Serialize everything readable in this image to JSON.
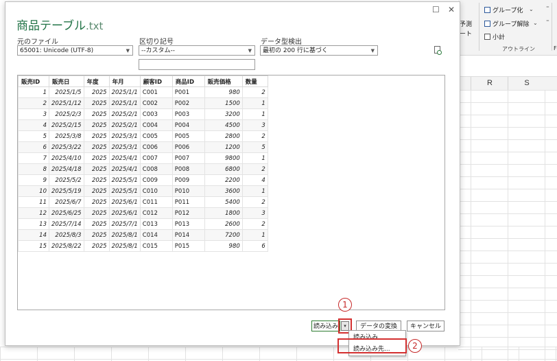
{
  "ribbon": {
    "items": [
      {
        "label": "グループ化",
        "icon": "group-icon"
      },
      {
        "label": "グループ解除",
        "icon": "ungroup-icon"
      },
      {
        "label": "小計",
        "icon": "subtotal-icon"
      }
    ],
    "group_label": "アウトライン",
    "partial_left_1": "予測",
    "partial_left_2": "ート",
    "partial_right": "F"
  },
  "spreadsheet": {
    "columns": [
      "R",
      "S"
    ]
  },
  "dialog": {
    "title": "商品テーブル",
    "title_ext": ".txt",
    "file_origin": {
      "label": "元のファイル",
      "value": "65001: Unicode (UTF-8)"
    },
    "delimiter": {
      "label": "区切り記号",
      "value": "--カスタム--",
      "custom_value": ""
    },
    "datatype": {
      "label": "データ型検出",
      "value": "最初の 200 行に基づく"
    },
    "table": {
      "headers": [
        "販売ID",
        "販売日",
        "年度",
        "年月",
        "顧客ID",
        "商品ID",
        "販売価格",
        "数量"
      ],
      "rows": [
        [
          "1",
          "2025/1/5",
          "2025",
          "2025/1/1",
          "C001",
          "P001",
          "980",
          "2"
        ],
        [
          "2",
          "2025/1/12",
          "2025",
          "2025/1/1",
          "C002",
          "P002",
          "1500",
          "1"
        ],
        [
          "3",
          "2025/2/3",
          "2025",
          "2025/2/1",
          "C003",
          "P003",
          "3200",
          "1"
        ],
        [
          "4",
          "2025/2/15",
          "2025",
          "2025/2/1",
          "C004",
          "P004",
          "4500",
          "3"
        ],
        [
          "5",
          "2025/3/8",
          "2025",
          "2025/3/1",
          "C005",
          "P005",
          "2800",
          "2"
        ],
        [
          "6",
          "2025/3/22",
          "2025",
          "2025/3/1",
          "C006",
          "P006",
          "1200",
          "5"
        ],
        [
          "7",
          "2025/4/10",
          "2025",
          "2025/4/1",
          "C007",
          "P007",
          "9800",
          "1"
        ],
        [
          "8",
          "2025/4/18",
          "2025",
          "2025/4/1",
          "C008",
          "P008",
          "6800",
          "2"
        ],
        [
          "9",
          "2025/5/2",
          "2025",
          "2025/5/1",
          "C009",
          "P009",
          "2200",
          "4"
        ],
        [
          "10",
          "2025/5/19",
          "2025",
          "2025/5/1",
          "C010",
          "P010",
          "3600",
          "1"
        ],
        [
          "11",
          "2025/6/7",
          "2025",
          "2025/6/1",
          "C011",
          "P011",
          "5400",
          "2"
        ],
        [
          "12",
          "2025/6/25",
          "2025",
          "2025/6/1",
          "C012",
          "P012",
          "1800",
          "3"
        ],
        [
          "13",
          "2025/7/14",
          "2025",
          "2025/7/1",
          "C013",
          "P013",
          "2600",
          "2"
        ],
        [
          "14",
          "2025/8/3",
          "2025",
          "2025/8/1",
          "C014",
          "P014",
          "7200",
          "1"
        ],
        [
          "15",
          "2025/8/22",
          "2025",
          "2025/8/1",
          "C015",
          "P015",
          "980",
          "6"
        ]
      ]
    },
    "buttons": {
      "load": "読み込み",
      "transform": "データの変換",
      "cancel": "キャンセル"
    },
    "load_menu": {
      "items": [
        "読み込み",
        "読み込み先..."
      ]
    }
  },
  "callouts": {
    "one": "1",
    "two": "2"
  },
  "colors": {
    "title": "#217346",
    "highlight": "#d32f2f"
  }
}
